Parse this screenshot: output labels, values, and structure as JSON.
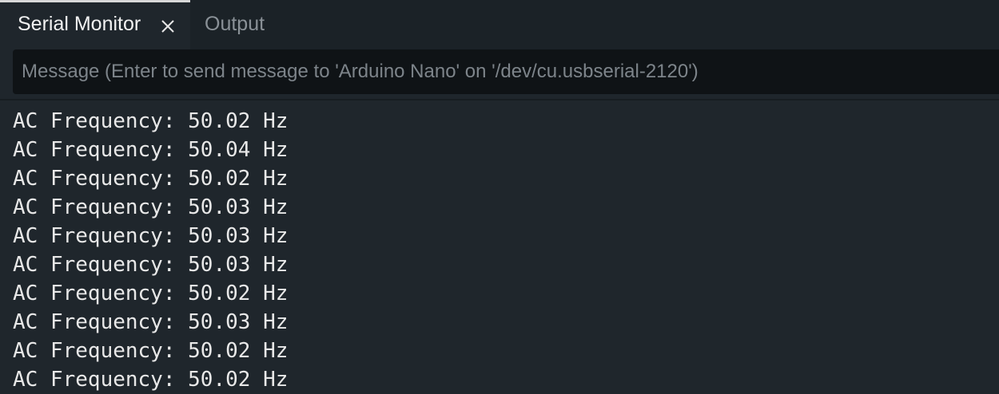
{
  "tabs": [
    {
      "label": "Serial Monitor",
      "active": true,
      "closable": true
    },
    {
      "label": "Output",
      "active": false
    }
  ],
  "message": {
    "placeholder": "Message (Enter to send message to 'Arduino Nano' on '/dev/cu.usbserial-2120')",
    "value": ""
  },
  "serial_output": [
    "AC Frequency: 50.02 Hz",
    "AC Frequency: 50.04 Hz",
    "AC Frequency: 50.02 Hz",
    "AC Frequency: 50.03 Hz",
    "AC Frequency: 50.03 Hz",
    "AC Frequency: 50.03 Hz",
    "AC Frequency: 50.02 Hz",
    "AC Frequency: 50.03 Hz",
    "AC Frequency: 50.02 Hz",
    "AC Frequency: 50.02 Hz"
  ],
  "icons": {
    "close": "close-icon"
  },
  "colors": {
    "background": "#1f262c",
    "input_background": "#0f1316",
    "text": "#e8e8e8",
    "inactive_tab_text": "#8a9197"
  }
}
